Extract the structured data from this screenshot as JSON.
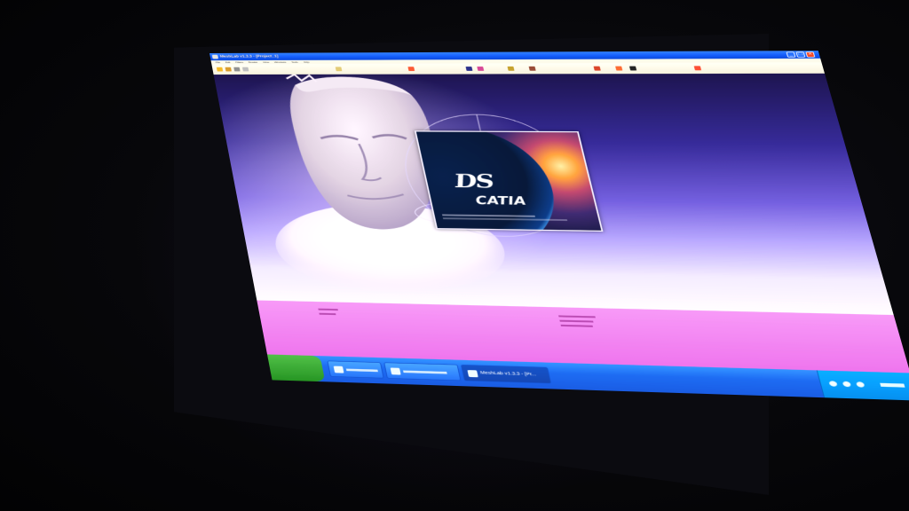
{
  "window": {
    "title": "MeshLab v1.3.3 - [Project_1]",
    "controls": {
      "minimize": "_",
      "maximize": "□",
      "close": "×"
    }
  },
  "menu": {
    "items": [
      "File",
      "Edit",
      "Filters",
      "Render",
      "View",
      "Windows",
      "Tools",
      "Help"
    ]
  },
  "toolbar": {
    "icons": [
      "open-icon",
      "save-icon",
      "snapshot-icon",
      "layers-icon",
      "light-icon",
      "rotate-icon",
      "color-icon",
      "texture-icon",
      "render-mode-icon",
      "measure-icon",
      "pick-icon",
      "select-icon",
      "paint-icon",
      "align-icon"
    ]
  },
  "splash": {
    "logo_mark": "DS",
    "product": "CATIA"
  },
  "status": {
    "left_info": [
      "",
      ""
    ],
    "center_info": [
      "",
      "",
      ""
    ]
  },
  "taskbar": {
    "items": [
      "",
      "",
      "MeshLab v1.3.3 - [Pr..."
    ]
  },
  "colors": {
    "titlebar": "#1a56d8",
    "viewport_top": "#1c1546",
    "viewport_bottom": "#f6f2ff",
    "status_panel": "#e496e4",
    "taskbar": "#2566d6",
    "start_button": "#2f8b2c"
  }
}
